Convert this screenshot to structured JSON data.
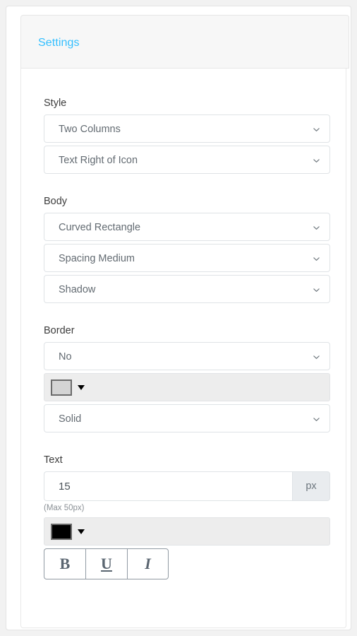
{
  "panel": {
    "tab_label": "Settings",
    "accent_color": "#33bfff"
  },
  "sections": {
    "style": {
      "label": "Style",
      "columns_select": "Two Columns",
      "icon_position_select": "Text Right of Icon"
    },
    "body": {
      "label": "Body",
      "shape_select": "Curved Rectangle",
      "spacing_select": "Spacing Medium",
      "effect_select": "Shadow"
    },
    "border": {
      "label": "Border",
      "enabled_select": "No",
      "color_value": "#d4d4d4",
      "style_select": "Solid"
    },
    "text": {
      "label": "Text",
      "size_value": "15",
      "size_unit": "px",
      "size_hint": "(Max 50px)",
      "color_value": "#000000",
      "bold_label": "B",
      "underline_label": "U",
      "italic_label": "I"
    }
  }
}
